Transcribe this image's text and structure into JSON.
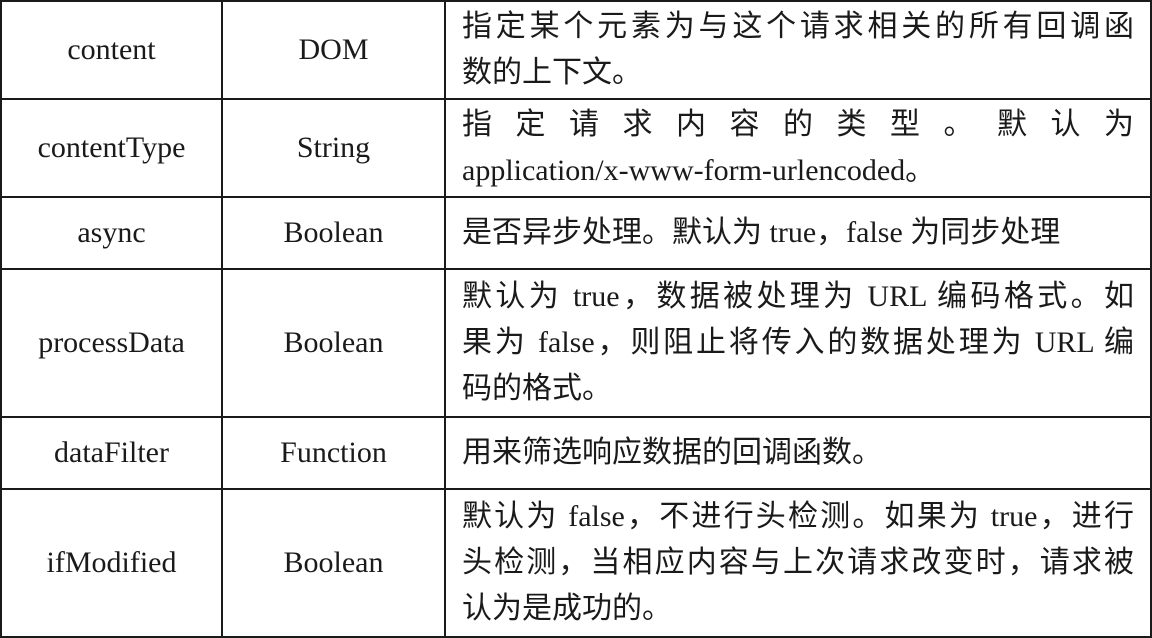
{
  "table": {
    "rows": [
      {
        "name": "content",
        "type": "DOM",
        "desc_lines": [
          "指定某个元素为与这个请求相关的所有回调函",
          "数的上下文。"
        ]
      },
      {
        "name": "contentType",
        "type": "String",
        "desc_lines": [
          "指定请求内容的类型。默认为",
          "application/x-www-form-urlencoded。"
        ]
      },
      {
        "name": "async",
        "type": "Boolean",
        "desc_lines": [
          "是否异步处理。默认为 true，false 为同步处理"
        ]
      },
      {
        "name": "processData",
        "type": "Boolean",
        "desc_lines": [
          "默认为 true，数据被处理为 URL 编码格式。如",
          "果为 false，则阻止将传入的数据处理为 URL 编",
          "码的格式。"
        ]
      },
      {
        "name": "dataFilter",
        "type": "Function",
        "desc_lines": [
          "用来筛选响应数据的回调函数。"
        ]
      },
      {
        "name": "ifModified",
        "type": "Boolean",
        "desc_lines": [
          "默认为 false，不进行头检测。如果为 true，进行",
          "头检测，当相应内容与上次请求改变时，请求被",
          "认为是成功的。"
        ]
      }
    ]
  }
}
